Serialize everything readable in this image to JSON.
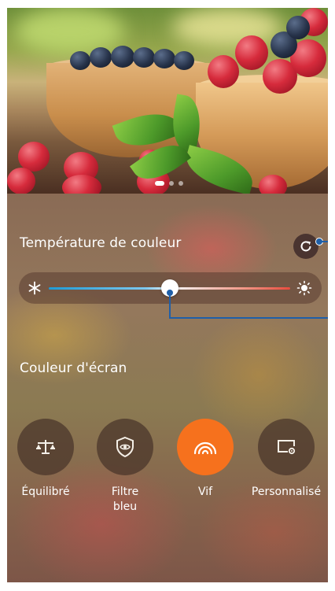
{
  "preview": {
    "image_description_name": "berries-photo",
    "page_indicator": {
      "count": 3,
      "active_index": 0
    }
  },
  "color_temperature": {
    "title": "Température de couleur",
    "reset_icon": "refresh-icon",
    "cold_icon": "snowflake-icon",
    "warm_icon": "sun-icon",
    "value": 0.5,
    "track_colors": [
      "#1e9bd6",
      "#f4f4f4",
      "#e84c3e"
    ]
  },
  "screen_color": {
    "title": "Couleur d'écran",
    "modes": [
      {
        "label": "Équilibré",
        "icon": "balance-scale-icon",
        "selected": false
      },
      {
        "label": "Filtre\nbleu",
        "icon": "eye-shield-icon",
        "selected": false
      },
      {
        "label": "Vif",
        "icon": "rainbow-icon",
        "selected": true
      },
      {
        "label": "Personnalisé",
        "icon": "custom-screen-icon",
        "selected": false
      }
    ]
  },
  "colors": {
    "accent": "#f6711d",
    "callout": "#1f5fa8"
  }
}
